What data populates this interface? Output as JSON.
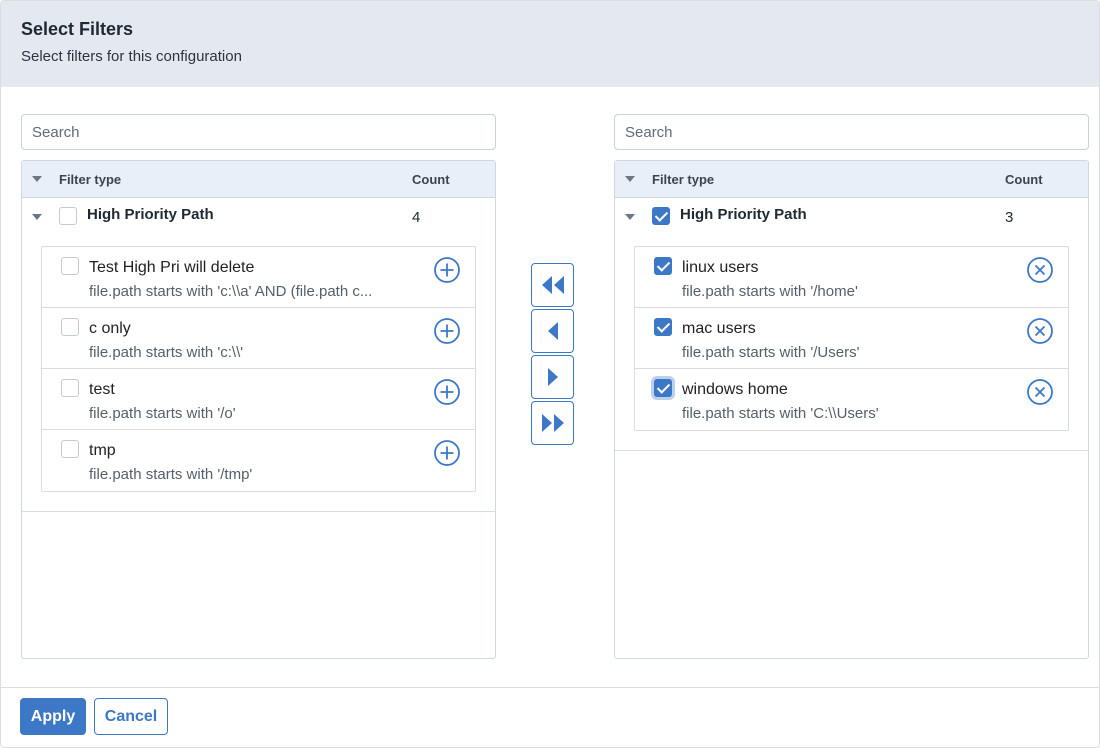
{
  "header": {
    "title": "Select Filters",
    "subtitle": "Select filters for this configuration"
  },
  "left_panel": {
    "search_placeholder": "Search",
    "columns": {
      "type": "Filter type",
      "count": "Count"
    },
    "group": {
      "label": "High Priority Path",
      "count": "4",
      "checked": false
    },
    "items": [
      {
        "label": "Test High Pri will delete",
        "desc": "file.path starts with 'c:\\\\a' AND (file.path c...",
        "checked": false,
        "action": "add-circle-icon"
      },
      {
        "label": "c only",
        "desc": "file.path starts with 'c:\\\\'",
        "checked": false,
        "action": "add-circle-icon"
      },
      {
        "label": "test",
        "desc": "file.path starts with '/o'",
        "checked": false,
        "action": "add-circle-icon"
      },
      {
        "label": "tmp",
        "desc": "file.path starts with '/tmp'",
        "checked": false,
        "action": "add-circle-icon"
      }
    ]
  },
  "right_panel": {
    "search_placeholder": "Search",
    "columns": {
      "type": "Filter type",
      "count": "Count"
    },
    "group": {
      "label": "High Priority Path",
      "count": "3",
      "checked": true
    },
    "items": [
      {
        "label": "linux users",
        "desc": "file.path starts with '/home'",
        "checked": true,
        "action": "remove-circle-icon"
      },
      {
        "label": "mac users",
        "desc": "file.path starts with '/Users'",
        "checked": true,
        "action": "remove-circle-icon"
      },
      {
        "label": "windows home",
        "desc": "file.path starts with 'C:\\\\Users'",
        "checked": true,
        "action": "remove-circle-icon"
      }
    ]
  },
  "movers": [
    "move-all-left-icon",
    "move-left-icon",
    "move-right-icon",
    "move-all-right-icon"
  ],
  "footer": {
    "apply_label": "Apply",
    "cancel_label": "Cancel"
  },
  "colors": {
    "accent": "#3d78c7",
    "header_bg": "#e4e9f0",
    "table_head_bg": "#e8eff8"
  }
}
